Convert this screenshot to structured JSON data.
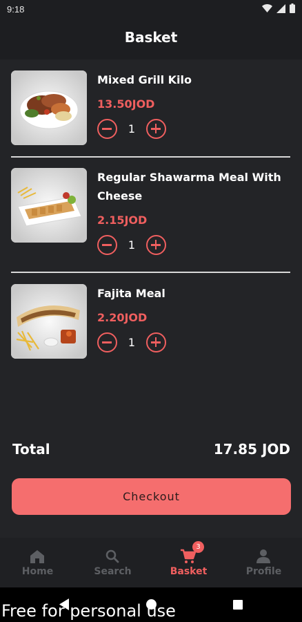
{
  "status_bar": {
    "time": "9:18"
  },
  "header": {
    "title": "Basket"
  },
  "items": [
    {
      "name": "Mixed Grill Kilo",
      "price": "13.50JOD",
      "quantity": "1",
      "image": "mixed-grill-photo"
    },
    {
      "name": "Regular Shawarma Meal With Cheese",
      "price": "2.15JOD",
      "quantity": "1",
      "image": "shawarma-meal-photo"
    },
    {
      "name": "Fajita Meal",
      "price": "2.20JOD",
      "quantity": "1",
      "image": "fajita-meal-photo"
    }
  ],
  "summary": {
    "total_label": "Total",
    "total_value": "17.85 JOD"
  },
  "checkout": {
    "label": "Checkout"
  },
  "tabs": [
    {
      "label": "Home",
      "icon": "home-icon"
    },
    {
      "label": "Search",
      "icon": "search-icon"
    },
    {
      "label": "Basket",
      "icon": "cart-icon",
      "badge": "3",
      "active": true
    },
    {
      "label": "Profile",
      "icon": "person-icon"
    }
  ],
  "watermark": "Free for personal use",
  "colors": {
    "accent": "#f05f5f",
    "background": "#232427",
    "button": "#f56e6e"
  }
}
